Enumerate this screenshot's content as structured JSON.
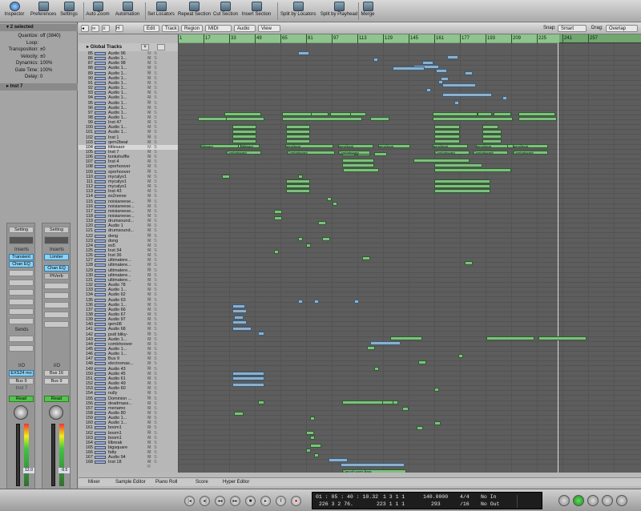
{
  "toolbar": {
    "buttons": [
      {
        "label": "Inspector",
        "icon": "info-icon"
      },
      {
        "label": "Preferences",
        "icon": "preferences-icon"
      },
      {
        "label": "Settings",
        "icon": "settings-icon"
      },
      {
        "label": "Auto Zoom",
        "icon": "zoom-icon"
      },
      {
        "label": "Automation",
        "icon": "automation-icon"
      },
      {
        "label": "Set Locators",
        "icon": "locators-icon"
      },
      {
        "label": "Repeat Section",
        "icon": "repeat-icon"
      },
      {
        "label": "Cut Section",
        "icon": "cut-icon"
      },
      {
        "label": "Insert Section",
        "icon": "insert-icon"
      },
      {
        "label": "Split by Locators",
        "icon": "split-locators-icon"
      },
      {
        "label": "Split by Playhead",
        "icon": "split-playhead-icon"
      },
      {
        "label": "Merge",
        "icon": "merge-icon"
      }
    ]
  },
  "inspector": {
    "region_header": "2 selected",
    "params": [
      {
        "key": "Quantize:",
        "value": "off (3840)"
      },
      {
        "key": "Loop:",
        "value": ""
      },
      {
        "key": "Transposition:",
        "value": "±0"
      },
      {
        "key": "Velocity:",
        "value": "±0"
      },
      {
        "key": "Dynamics:",
        "value": "100%"
      },
      {
        "key": "Gate Time:",
        "value": "100%"
      },
      {
        "key": "Delay:",
        "value": "0"
      }
    ],
    "track_header": "Inst 7",
    "left_strip": {
      "setting": "Setting",
      "inserts_label": "Inserts",
      "insert1": "Transient",
      "insert2": "Chan EQ",
      "sends_label": "Sends",
      "io_label": "I/O",
      "input": "EXS24 mo",
      "output": "Bus 9",
      "name": "Inst 7",
      "automation": "Read",
      "level": "12.0"
    },
    "right_strip": {
      "setting": "Setting",
      "inserts_label": "Inserts",
      "insert1": "Limiter",
      "insert2": "Chan EQ",
      "insert3": "PtVerb",
      "io_label": "I/O",
      "input": "Bus 16",
      "output": "Bus 9",
      "automation": "Read",
      "level": "-9.5"
    }
  },
  "arrange": {
    "menus": [
      "Edit",
      "Track",
      "Region",
      "MIDI",
      "Audio",
      "View"
    ],
    "snap_label": "Snap:",
    "snap_value": "Smart",
    "drag_label": "Drag:",
    "drag_value": "Overlap",
    "global_tracks": "Global Tracks",
    "ruler": [
      "1",
      "17",
      "33",
      "49",
      "65",
      "81",
      "97",
      "113",
      "129",
      "145",
      "161",
      "177",
      "193",
      "209",
      "225",
      "241",
      "257"
    ],
    "tracks": [
      {
        "n": "85",
        "name": "Audio 96"
      },
      {
        "n": "86",
        "name": "Audio 1..."
      },
      {
        "n": "87",
        "name": "Audio 98"
      },
      {
        "n": "88",
        "name": "Audio 1..."
      },
      {
        "n": "89",
        "name": "Audio 1..."
      },
      {
        "n": "90",
        "name": "Audio 1..."
      },
      {
        "n": "91",
        "name": "Audio 1..."
      },
      {
        "n": "92",
        "name": "Audio 1..."
      },
      {
        "n": "93",
        "name": "Audio 1..."
      },
      {
        "n": "94",
        "name": "Audio 1..."
      },
      {
        "n": "95",
        "name": "Audio 1..."
      },
      {
        "n": "96",
        "name": "Audio 1..."
      },
      {
        "n": "97",
        "name": "Audio 1..."
      },
      {
        "n": "98",
        "name": "Audio 1..."
      },
      {
        "n": "99",
        "name": "Inst 47"
      },
      {
        "n": "100",
        "name": "Audio 1..."
      },
      {
        "n": "101",
        "name": "Audio 1..."
      },
      {
        "n": "102",
        "name": "Inst 1"
      },
      {
        "n": "103",
        "name": "qem2beat"
      },
      {
        "n": "104",
        "name": "littlesaor"
      },
      {
        "n": "105",
        "name": "Inst 7"
      },
      {
        "n": "106",
        "name": "tonkshuffle"
      },
      {
        "n": "107",
        "name": "Inst 4"
      },
      {
        "n": "108",
        "name": "sporhoover"
      },
      {
        "n": "109",
        "name": "sporhoover"
      },
      {
        "n": "110",
        "name": "mycalyx1"
      },
      {
        "n": "111",
        "name": "mycalyx1"
      },
      {
        "n": "112",
        "name": "mycalyx1"
      },
      {
        "n": "113",
        "name": "Inst 43"
      },
      {
        "n": "114",
        "name": "es2reese"
      },
      {
        "n": "115",
        "name": "noisiareese..."
      },
      {
        "n": "116",
        "name": "noisiareese..."
      },
      {
        "n": "117",
        "name": "noisiareese..."
      },
      {
        "n": "118",
        "name": "noisiareese..."
      },
      {
        "n": "119",
        "name": "drumsound..."
      },
      {
        "n": "120",
        "name": "Audio 1"
      },
      {
        "n": "121",
        "name": "drumsound..."
      },
      {
        "n": "122",
        "name": "dong"
      },
      {
        "n": "123",
        "name": "dong"
      },
      {
        "n": "124",
        "name": "es5"
      },
      {
        "n": "125",
        "name": "Inst 34"
      },
      {
        "n": "126",
        "name": "Inst 36"
      },
      {
        "n": "127",
        "name": "ultimatere..."
      },
      {
        "n": "128",
        "name": "ultimatere..."
      },
      {
        "n": "129",
        "name": "ultimatere..."
      },
      {
        "n": "130",
        "name": "ultimatere..."
      },
      {
        "n": "131",
        "name": "ultimatere..."
      },
      {
        "n": "132",
        "name": "Audio 78"
      },
      {
        "n": "133",
        "name": "Audio 1..."
      },
      {
        "n": "134",
        "name": "Audio 62"
      },
      {
        "n": "135",
        "name": "Audio 63"
      },
      {
        "n": "136",
        "name": "Audio 1..."
      },
      {
        "n": "137",
        "name": "Audio 66"
      },
      {
        "n": "138",
        "name": "Audio 67"
      },
      {
        "n": "139",
        "name": "Audio 97"
      },
      {
        "n": "140",
        "name": "qem08"
      },
      {
        "n": "141",
        "name": "Audio 68"
      },
      {
        "n": "142",
        "name": "psdi bliky-"
      },
      {
        "n": "143",
        "name": "Audio 1..."
      },
      {
        "n": "144",
        "name": "combhoover"
      },
      {
        "n": "145",
        "name": "Audio 1..."
      },
      {
        "n": "146",
        "name": "Audio 1..."
      },
      {
        "n": "147",
        "name": "Bus 9"
      },
      {
        "n": "148",
        "name": "electromas..."
      },
      {
        "n": "149",
        "name": "Audio 43"
      },
      {
        "n": "150",
        "name": "Audio 45"
      },
      {
        "n": "151",
        "name": "Audio 61"
      },
      {
        "n": "152",
        "name": "Audio 49"
      },
      {
        "n": "153",
        "name": "Audio 60"
      },
      {
        "n": "154",
        "name": "nully"
      },
      {
        "n": "155",
        "name": "Dominion ..."
      },
      {
        "n": "156",
        "name": "deadmass..."
      },
      {
        "n": "157",
        "name": "menamo"
      },
      {
        "n": "158",
        "name": "Audio 80"
      },
      {
        "n": "159",
        "name": "Audio 1..."
      },
      {
        "n": "160",
        "name": "Audio 1..."
      },
      {
        "n": "161",
        "name": "boom1"
      },
      {
        "n": "162",
        "name": "boom1"
      },
      {
        "n": "163",
        "name": "boom1"
      },
      {
        "n": "164",
        "name": "lilbreak"
      },
      {
        "n": "165",
        "name": "bigsquare"
      },
      {
        "n": "166",
        "name": "fatty"
      },
      {
        "n": "167",
        "name": "Audio 94"
      },
      {
        "n": "168",
        "name": "Inst 18"
      }
    ],
    "region_labels": [
      "littlesaor",
      "littlesaor",
      "gem2beat",
      "gem2beat",
      "gem2beat",
      "gem2beat",
      "gem2beat",
      "gem2beat",
      "Cymbalswash",
      "Cymbalswash",
      "Cymbalswash",
      "Cymbalswash",
      "Cymbalswash",
      "Cymbalswash",
      "CanonFuzzies Bass",
      "audio 5",
      "audio 5",
      "audio 5"
    ]
  },
  "bottom_tabs": [
    "Mixer",
    "Sample Editor",
    "Piano Roll",
    "Score",
    "Hyper Editor"
  ],
  "transport": {
    "smpte": "01 : 05 : 40 : 10.32",
    "bars": "226  3  2  76.",
    "left_locator": "1  3  1  1",
    "right_locator": "223  1  1  1",
    "tempo": "140.0000",
    "division": "293",
    "signature": "4/4",
    "subdivision": "/16",
    "midi_in": "No In",
    "midi_out": "No Out"
  }
}
